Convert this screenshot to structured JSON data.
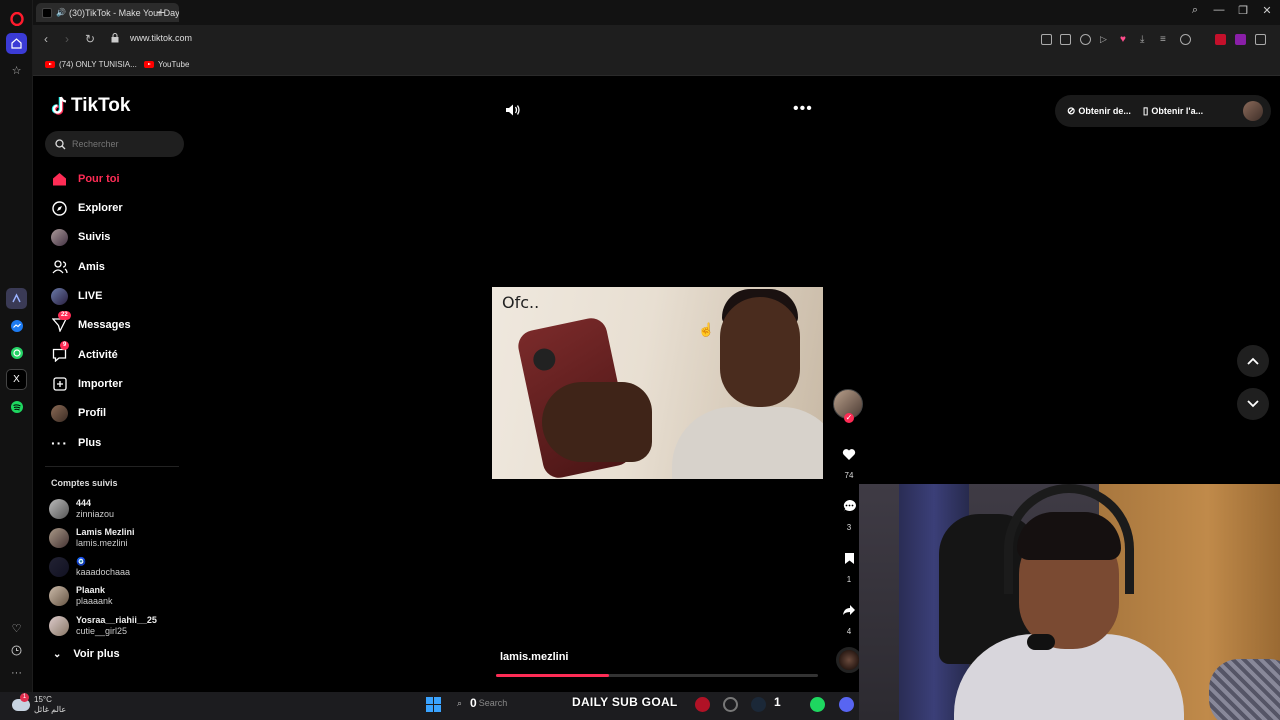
{
  "browser": {
    "tab_title": "(30)TikTok - Make Your Day",
    "url": "www.tiktok.com",
    "bookmarks": [
      {
        "label": "(74) ONLY TUNISIA..."
      },
      {
        "label": "YouTube"
      }
    ]
  },
  "tiktok": {
    "logo_text": "TikTok",
    "search_placeholder": "Rechercher",
    "nav": [
      {
        "label": "Pour toi",
        "icon": "home-icon",
        "active": true
      },
      {
        "label": "Explorer",
        "icon": "compass-icon"
      },
      {
        "label": "Suivis",
        "icon": "following-avatar-icon"
      },
      {
        "label": "Amis",
        "icon": "friends-icon"
      },
      {
        "label": "LIVE",
        "icon": "live-avatar-icon"
      },
      {
        "label": "Messages",
        "icon": "messages-icon",
        "badge": "22"
      },
      {
        "label": "Activité",
        "icon": "activity-icon",
        "badge": "9"
      },
      {
        "label": "Importer",
        "icon": "upload-icon"
      },
      {
        "label": "Profil",
        "icon": "profile-avatar-icon"
      },
      {
        "label": "Plus",
        "icon": "more-dots-icon"
      }
    ],
    "followed_title": "Comptes suivis",
    "followed": [
      {
        "name": "444",
        "handle": "zinniazou"
      },
      {
        "name": "Lamis Mezlini",
        "handle": "lamis.mezlini"
      },
      {
        "name": "🧿",
        "handle": "kaaadochaaa"
      },
      {
        "name": "Plaank",
        "handle": "plaaaank"
      },
      {
        "name": "Yosraa__riahii__25",
        "handle": "cutie__girl25"
      }
    ],
    "see_more": "Voir plus",
    "top_right": {
      "get_coins": "Obtenir de...",
      "get_app": "Obtenir l'a..."
    },
    "video": {
      "caption_text": "Ofc..",
      "author": "lamis.mezlini",
      "progress": 0.35,
      "likes": "74",
      "comments": "3",
      "saves": "1",
      "shares": "4"
    }
  },
  "taskbar": {
    "temperature": "15°C",
    "weather_sub": "عالم غائل",
    "weather_badge": "1",
    "search_text": "Search",
    "search_overlay_num": "0",
    "sub_goal": "DAILY SUB GOAL",
    "count": "1"
  },
  "colors": {
    "accent": "#fe2c55",
    "background": "#000000"
  }
}
